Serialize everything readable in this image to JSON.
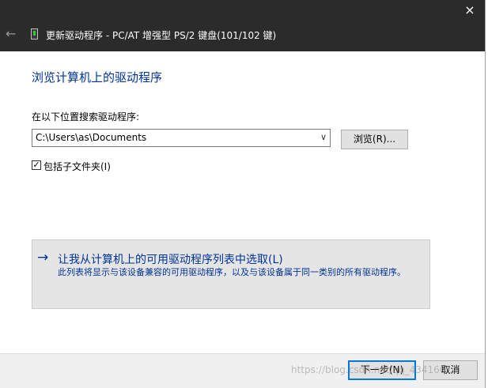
{
  "window": {
    "title": "更新驱动程序 - PC/AT 增强型 PS/2 键盘(101/102 键)",
    "close_icon": "×",
    "back_icon": "←"
  },
  "main": {
    "heading": "浏览计算机上的驱动程序",
    "search_label": "在以下位置搜索驱动程序:",
    "path_value": "C:\\Users\\as\\Documents",
    "dropdown_icon": "∨",
    "browse_label": "浏览(R)...",
    "include_subfolders": {
      "checked": true,
      "check_glyph": "✓",
      "label": "包括子文件夹(I)"
    },
    "pick_option": {
      "arrow": "→",
      "title": "让我从计算机上的可用驱动程序列表中选取(L)",
      "description": "此列表将显示与该设备兼容的可用驱动程序，以及与该设备属于同一类别的所有驱动程序。"
    }
  },
  "footer": {
    "next_label": "下一步(N)",
    "cancel_label": "取消"
  },
  "watermark": "https://blog.csdn.net/qq_43416612"
}
